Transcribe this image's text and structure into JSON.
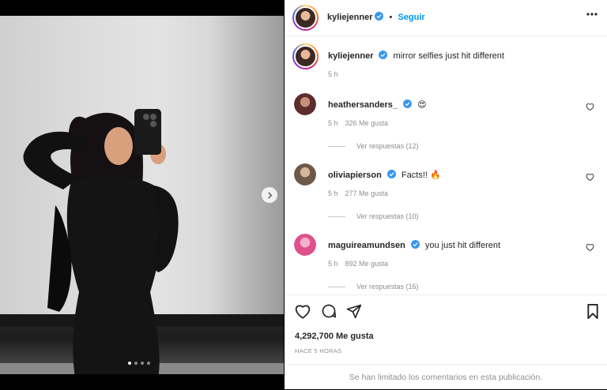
{
  "post": {
    "author": "kyliejenner",
    "follow_label": "Seguir",
    "caption": "mirror selfies just hit different",
    "caption_time": "5 h",
    "likes": "4,292,700 Me gusta",
    "posted_ago": "HACE 5 HORAS",
    "limited_comments": "Se han limitado los comentarios en esta publicación."
  },
  "carousel": {
    "slide_count": 4,
    "active_index": 0
  },
  "comments": [
    {
      "username": "heathersanders_",
      "verified": true,
      "text": "😍",
      "time": "5 h",
      "likes": "326 Me gusta",
      "replies": "Ver respuestas (12)"
    },
    {
      "username": "oliviapierson",
      "verified": true,
      "text": "Facts!! 🔥",
      "time": "5 h",
      "likes": "277 Me gusta",
      "replies": "Ver respuestas (10)"
    },
    {
      "username": "maguireamundsen",
      "verified": true,
      "text": "you just hit different",
      "time": "5 h",
      "likes": "892 Me gusta",
      "replies": "Ver respuestas (16)"
    }
  ],
  "colors": {
    "accent": "#0095f6",
    "verified": "#3897f0",
    "muted": "#8e8e8e"
  },
  "icons": [
    "verified-icon",
    "more-options-icon",
    "heart-icon",
    "comment-icon",
    "share-icon",
    "bookmark-icon",
    "chevron-right-icon"
  ]
}
